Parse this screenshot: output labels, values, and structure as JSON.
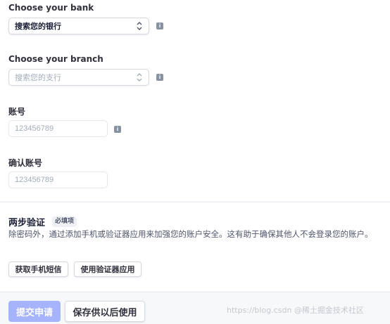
{
  "bank": {
    "label": "Choose your bank",
    "value": "搜索您的银行"
  },
  "branch": {
    "label": "Choose your branch",
    "value": "搜索您的支行"
  },
  "account": {
    "label": "账号",
    "placeholder": "123456789"
  },
  "confirm_account": {
    "label": "确认账号",
    "placeholder": "123456789"
  },
  "two_step": {
    "title": "两步验证",
    "badge": "必填项",
    "description": "除密码外，通过添加手机或验证器应用来加强您的账户安全。这有助于确保其他人不会登录您的账户。",
    "sms_button": "获取手机短信",
    "app_button": "使用验证器应用"
  },
  "footer": {
    "submit": "提交申请",
    "save": "保存供以后使用",
    "watermark": "https://blog.csdn @稀土掘金技术社区"
  },
  "icons": {
    "info": "info-icon",
    "chevron": "chevron-up-down-icon"
  },
  "colors": {
    "primary_disabled": "#a5b4fc",
    "text": "#1a1f36",
    "muted": "#a3acb9"
  }
}
